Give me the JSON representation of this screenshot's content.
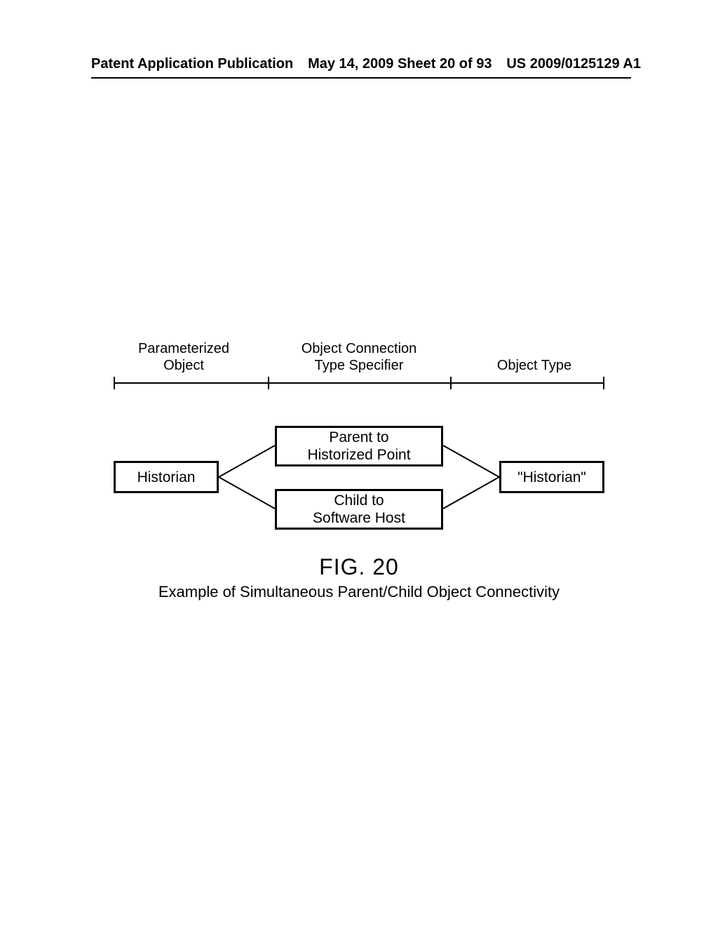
{
  "header": {
    "left": "Patent Application Publication",
    "center": "May 14, 2009  Sheet 20 of 93",
    "right": "US 2009/0125129 A1"
  },
  "columns": {
    "col1": {
      "line1": "Parameterized",
      "line2": "Object"
    },
    "col2": {
      "line1": "Object Connection",
      "line2": "Type Specifier"
    },
    "col3": {
      "line1": "Object Type"
    }
  },
  "boxes": {
    "left": "Historian",
    "mid_top": {
      "line1": "Parent to",
      "line2": "Historized Point"
    },
    "mid_bottom": {
      "line1": "Child to",
      "line2": "Software Host"
    },
    "right": "\"Historian\""
  },
  "figure": {
    "number": "FIG. 20",
    "caption": "Example of Simultaneous Parent/Child Object Connectivity"
  }
}
